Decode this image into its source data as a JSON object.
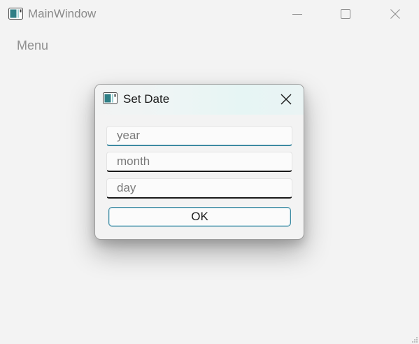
{
  "window": {
    "title": "MainWindow",
    "icon": "app-window-icon",
    "controls": [
      "minimize-icon",
      "maximize-icon",
      "close-icon"
    ]
  },
  "menu": {
    "items": [
      {
        "label": "Menu"
      }
    ]
  },
  "dialog": {
    "title": "Set Date",
    "icon": "app-window-icon",
    "close_icon": "close-icon",
    "fields": {
      "year": {
        "value": "",
        "placeholder": "year"
      },
      "month": {
        "value": "",
        "placeholder": "month"
      },
      "day": {
        "value": "",
        "placeholder": "day"
      }
    },
    "ok_label": "OK"
  },
  "colors": {
    "window_background": "#f3f3f3",
    "accent": "#3d8aa2",
    "dialog_border": "#9c9c9c"
  }
}
